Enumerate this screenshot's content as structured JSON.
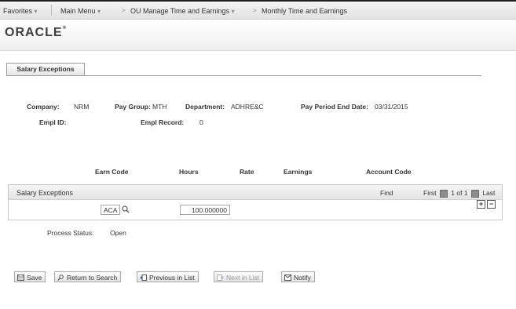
{
  "breadcrumbs": {
    "favorites": "Favorites",
    "main_menu": "Main Menu",
    "ou_manage": "OU Manage Time and Earnings",
    "monthly": "Monthly Time and Earnings",
    "dropdown_glyph": "▾",
    "arrow_glyph": ">"
  },
  "brand": {
    "logo": "ORACLE",
    "reg": "®"
  },
  "tabs": {
    "salary_exceptions": "Salary Exceptions"
  },
  "header_fields": {
    "company_label": "Company:",
    "company_value": "NRM",
    "pay_group_label": "Pay Group:",
    "pay_group_value": "MTH",
    "department_label": "Department:",
    "department_value": "ADHRE&C",
    "pay_period_label": "Pay Period End Date:",
    "pay_period_value": "03/31/2015",
    "empl_id_label": "Empl ID:",
    "empl_record_label": "Empl Record:",
    "empl_record_value": "0"
  },
  "columns": {
    "earn_code": "Earn Code",
    "hours": "Hours",
    "rate": "Rate",
    "earnings": "Earnings",
    "account_code": "Account Code"
  },
  "grid": {
    "title": "Salary Exceptions",
    "find": "Find",
    "first": "First",
    "range": "1 of 1",
    "last": "Last",
    "row": {
      "earn_code": "ACA",
      "hours": "100.000000"
    },
    "add_glyph": "+",
    "remove_glyph": "−"
  },
  "process_status": {
    "label": "Process Status:",
    "value": "Open"
  },
  "toolbar": {
    "save": "Save",
    "return_to_search": "Return to Search",
    "previous_in_list": "Previous in List",
    "next_in_list": "Next in List",
    "notify": "Notify"
  },
  "colors": {
    "icon_blue": "#4a79b8",
    "nav_grey": "#8c8c8c"
  }
}
